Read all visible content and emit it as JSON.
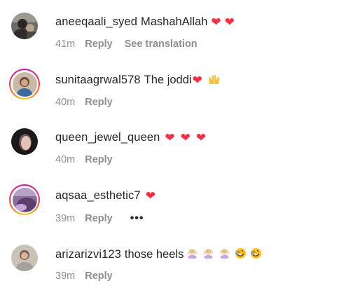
{
  "comments": [
    {
      "username": "aneeqaali_syed",
      "text": "MashahAllah",
      "emojis": [
        "heart",
        "heart"
      ],
      "time": "41m",
      "reply_label": "Reply",
      "extra_label": "See translation",
      "story_ring": false
    },
    {
      "username": "sunitaagrwal578",
      "text": "The joddi",
      "emojis": [
        "heart",
        "raising-hands"
      ],
      "time": "40m",
      "reply_label": "Reply",
      "story_ring": true
    },
    {
      "username": "queen_jewel_queen",
      "text": "",
      "emojis": [
        "heart",
        "heart",
        "heart"
      ],
      "time": "40m",
      "reply_label": "Reply",
      "story_ring": false
    },
    {
      "username": "aqsaa_esthetic7",
      "text": "",
      "emojis": [
        "heart"
      ],
      "time": "39m",
      "reply_label": "Reply",
      "more_label": "•••",
      "story_ring": true
    },
    {
      "username": "arizarizvi123",
      "text": "those heels",
      "emojis": [
        "woman-gesturing-ok",
        "woman-gesturing-ok",
        "woman-gesturing-ok",
        "rolling-on-floor-laughing",
        "rolling-on-floor-laughing"
      ],
      "time": "39m",
      "reply_label": "Reply",
      "story_ring": false
    }
  ],
  "colors": {
    "heart": "#ff2d3d",
    "meta_text": "#8e8e8e",
    "primary_text": "#262626"
  }
}
